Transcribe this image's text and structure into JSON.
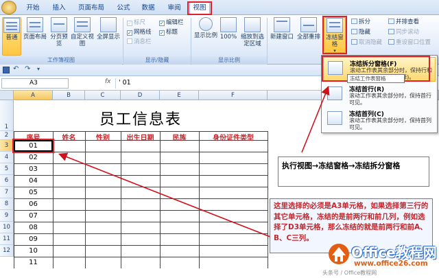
{
  "tabs": [
    "开始",
    "插入",
    "页面布局",
    "公式",
    "数据",
    "审阅",
    "视图"
  ],
  "active_tab": "视图",
  "ribbon": {
    "workbook_views": {
      "buttons": [
        "普通",
        "页面布局",
        "分页预览",
        "自定义视图",
        "全屏显示"
      ],
      "label": "工作簿视图"
    },
    "show_hide": {
      "checks": [
        {
          "label": "标尺",
          "checked": true,
          "enabled": false
        },
        {
          "label": "编辑栏",
          "checked": true,
          "enabled": true
        },
        {
          "label": "网格线",
          "checked": true,
          "enabled": true
        },
        {
          "label": "标题",
          "checked": true,
          "enabled": true
        },
        {
          "label": "消息栏",
          "checked": false,
          "enabled": false
        }
      ],
      "label": "显示/隐藏"
    },
    "zoom": {
      "buttons": [
        "显示比例",
        "100%",
        "缩放到选定区域"
      ],
      "label": "显示比例"
    },
    "window": {
      "buttons": [
        "新建窗口",
        "全部重排",
        "冻结窗格"
      ],
      "small": [
        "拆分",
        "隐藏",
        "取消隐藏"
      ],
      "small2": [
        "并排查看",
        "同步滚动",
        "重设窗口位置"
      ]
    }
  },
  "formula_bar": {
    "name_box": "A3",
    "fx": "fx",
    "value": "' 01"
  },
  "columns": [
    "A",
    "B",
    "C",
    "D",
    "E",
    "F"
  ],
  "rows": [
    "1",
    "2",
    "3",
    "4",
    "5",
    "6",
    "7",
    "8",
    "9",
    "10",
    "11",
    "12"
  ],
  "sheet": {
    "title": "员工信息表",
    "headers": [
      "序号",
      "姓名",
      "性别",
      "出生日期",
      "民族",
      "身份证件类型"
    ],
    "ids": [
      "01",
      "02",
      "03",
      "04",
      "05",
      "06",
      "07",
      "08",
      "09",
      "10",
      "11"
    ]
  },
  "dropdown": {
    "items": [
      {
        "title": "冻结拆分窗格(F)",
        "desc": "滚动工作表其余部分时，保持行和列可见(基于当前的选择)。"
      },
      {
        "title": "冻结首行(R)",
        "desc": "滚动工作表其余部分时，保持首行可见。"
      },
      {
        "title": "冻结首列(C)",
        "desc": "滚动工作表其余部分时，保持首列可见。"
      }
    ],
    "tooltip": "冻结工作表窗格"
  },
  "callouts": {
    "step": "执行视图→冻结窗格→冻结拆分窗格",
    "note": "这里选择的必须是A3单元格，如果选择第三行的其它单元格，冻结的是前两行和前几列，例如选择了D3单元格，那么冻结的就是前两行和前A、B、C三列。"
  },
  "watermark": {
    "brand": "Office教程网",
    "url": "www.office26.com",
    "faint": "头条号 / Office教程网"
  },
  "colors": {
    "accent_red": "#e0202a",
    "header_red": "#c0282d",
    "ribbon_blue": "#15428b"
  }
}
